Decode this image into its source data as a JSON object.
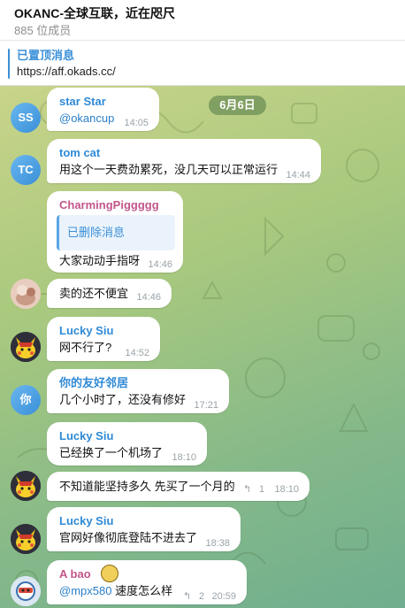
{
  "header": {
    "title": "OKANC-全球互联，近在咫尺",
    "subtitle": "885 位成员"
  },
  "pinned": {
    "label": "已置顶消息",
    "text": "https://aff.okads.cc/"
  },
  "date_chip": "6月6日",
  "colors": {
    "accent": "#3a8fd8",
    "sender_blue": "#2f8ad6",
    "sender_pink": "#c2568a",
    "sender_lavender": "#7e6fcf",
    "timestamp": "#9aa3a8"
  },
  "messages": [
    {
      "avatar_initials": "SS",
      "sender": "star Star",
      "mention": "@okancup",
      "text": "",
      "time": "14:05"
    },
    {
      "avatar_initials": "TC",
      "sender": "tom cat",
      "text": "用这个一天费劲累死，没几天可以正常运行",
      "time": "14:44"
    },
    {
      "sender": "CharmingPiggggg",
      "quote": "已删除消息",
      "text": "大家动动手指呀",
      "time": "14:46"
    },
    {
      "text": "卖的还不便宜",
      "time": "14:46"
    },
    {
      "sender": "Lucky Siu",
      "text": "网不行了?",
      "time": "14:52"
    },
    {
      "avatar_initials": "你",
      "sender": "你的友好邻居",
      "text": "几个小时了，还没有修好",
      "time": "17:21"
    },
    {
      "sender": "Lucky Siu",
      "text": "已经换了一个机场了",
      "time": "18:10"
    },
    {
      "text": "不知道能坚持多久 先买了一个月的",
      "reply_icon": "reply-arrow",
      "reply_count": "1",
      "time": "18:10"
    },
    {
      "sender": "Lucky Siu",
      "text": "官网好像彻底登陆不进去了",
      "time": "18:38"
    },
    {
      "sender": "A bao",
      "mention": "@mpx580",
      "text": "速度怎么样",
      "reply_icon": "reply-arrow",
      "reply_count": "2",
      "time": "20:59"
    }
  ]
}
